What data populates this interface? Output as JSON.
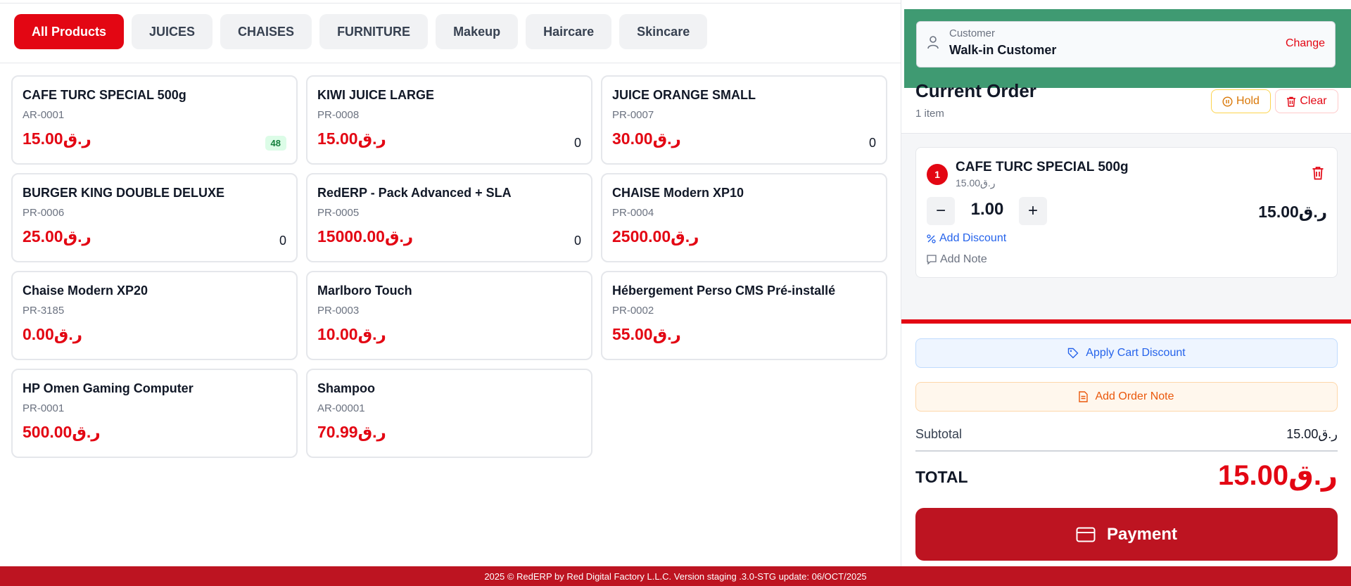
{
  "categories": [
    {
      "label": "All Products",
      "active": true
    },
    {
      "label": "JUICES"
    },
    {
      "label": "CHAISES"
    },
    {
      "label": "FURNITURE"
    },
    {
      "label": "Makeup"
    },
    {
      "label": "Haircare"
    },
    {
      "label": "Skincare"
    }
  ],
  "products": [
    {
      "name": "CAFE TURC SPECIAL 500g",
      "sku": "AR-0001",
      "price": "15.00ر.ق",
      "stock": "48",
      "stock_style": "badge"
    },
    {
      "name": "KIWI JUICE LARGE",
      "sku": "PR-0008",
      "price": "15.00ر.ق",
      "stock": "0"
    },
    {
      "name": "JUICE ORANGE SMALL",
      "sku": "PR-0007",
      "price": "30.00ر.ق",
      "stock": "0"
    },
    {
      "name": "BURGER KING DOUBLE DELUXE",
      "sku": "PR-0006",
      "price": "25.00ر.ق",
      "stock": "0"
    },
    {
      "name": "RedERP - Pack Advanced + SLA",
      "sku": "PR-0005",
      "price": "15000.00ر.ق",
      "stock": "0"
    },
    {
      "name": "CHAISE Modern XP10",
      "sku": "PR-0004",
      "price": "2500.00ر.ق",
      "stock": ""
    },
    {
      "name": "Chaise Modern XP20",
      "sku": "PR-3185",
      "price": "0.00ر.ق",
      "stock": ""
    },
    {
      "name": "Marlboro Touch",
      "sku": "PR-0003",
      "price": "10.00ر.ق",
      "stock": ""
    },
    {
      "name": "Hébergement Perso CMS Pré-installé",
      "sku": "PR-0002",
      "price": "55.00ر.ق",
      "stock": ""
    },
    {
      "name": "HP Omen Gaming Computer",
      "sku": "PR-0001",
      "price": "500.00ر.ق",
      "stock": ""
    },
    {
      "name": "Shampoo",
      "sku": "AR-00001",
      "price": "70.99ر.ق",
      "stock": ""
    }
  ],
  "customer": {
    "label": "Customer",
    "name": "Walk-in Customer",
    "change_label": "Change"
  },
  "order": {
    "title": "Current Order",
    "count": "1 item",
    "hold_label": "Hold",
    "clear_label": "Clear",
    "items": [
      {
        "index": "1",
        "name": "CAFE TURC SPECIAL 500g",
        "unit_price": "15.00ر.ق",
        "qty": "1.00",
        "line_total": "15.00ر.ق"
      }
    ],
    "add_discount_label": "Add Discount",
    "add_note_label": "Add Note"
  },
  "summary": {
    "cart_discount_label": "Apply Cart Discount",
    "order_note_label": "Add Order Note",
    "subtotal_label": "Subtotal",
    "subtotal_value": "15.00ر.ق",
    "total_label": "TOTAL",
    "total_value": "15.00ر.ق",
    "payment_label": "Payment"
  },
  "footer": {
    "text": "2025 © RedERP by Red Digital Factory L.L.C. Version staging .3.0-STG update: 06/OCT/2025"
  },
  "colors": {
    "accent": "#e30613",
    "payment": "#bd1421",
    "highlight_frame": "#3f9a72"
  }
}
